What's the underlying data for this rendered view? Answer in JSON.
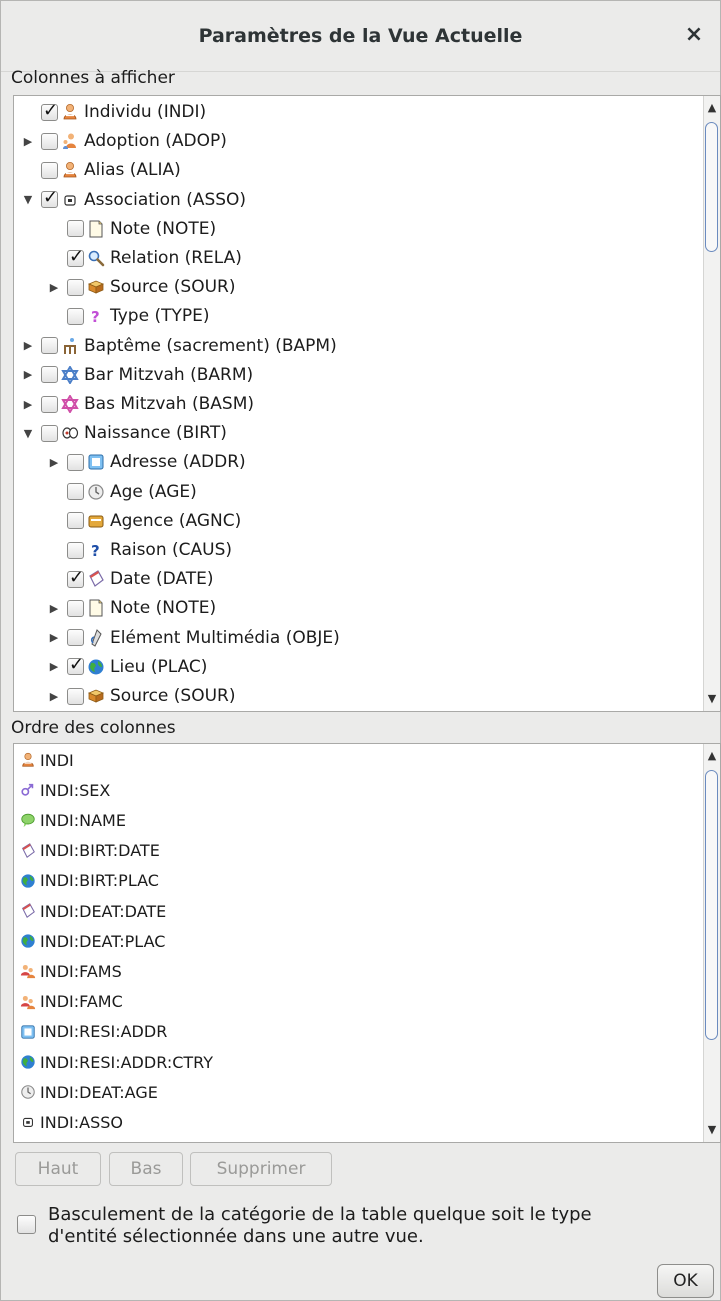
{
  "dialog": {
    "title": "Paramètres de la Vue Actuelle",
    "close_glyph": "×"
  },
  "columns_section": {
    "label": "Colonnes à afficher",
    "tree": [
      {
        "label": "Individu (INDI)",
        "checked": true,
        "toggle": "",
        "level": 0,
        "icon": "person-icon"
      },
      {
        "label": "Adoption (ADOP)",
        "checked": false,
        "toggle": "▶",
        "level": 0,
        "icon": "adoption-icon"
      },
      {
        "label": "Alias (ALIA)",
        "checked": false,
        "toggle": "",
        "level": 0,
        "icon": "person-icon"
      },
      {
        "label": "Association (ASSO)",
        "checked": true,
        "toggle": "▼",
        "level": 0,
        "icon": "association-icon"
      },
      {
        "label": "Note (NOTE)",
        "checked": false,
        "toggle": "",
        "level": 1,
        "icon": "note-icon"
      },
      {
        "label": "Relation (RELA)",
        "checked": true,
        "toggle": "",
        "level": 1,
        "icon": "magnifier-icon"
      },
      {
        "label": "Source (SOUR)",
        "checked": false,
        "toggle": "▶",
        "level": 1,
        "icon": "source-icon"
      },
      {
        "label": "Type (TYPE)",
        "checked": false,
        "toggle": "",
        "level": 1,
        "icon": "type-icon"
      },
      {
        "label": "Baptême (sacrement) (BAPM)",
        "checked": false,
        "toggle": "▶",
        "level": 0,
        "icon": "baptism-icon"
      },
      {
        "label": "Bar Mitzvah (BARM)",
        "checked": false,
        "toggle": "▶",
        "level": 0,
        "icon": "star-of-david-blue-icon"
      },
      {
        "label": "Bas Mitzvah (BASM)",
        "checked": false,
        "toggle": "▶",
        "level": 0,
        "icon": "star-of-david-pink-icon"
      },
      {
        "label": "Naissance (BIRT)",
        "checked": false,
        "toggle": "▼",
        "level": 0,
        "icon": "birth-icon"
      },
      {
        "label": "Adresse (ADDR)",
        "checked": false,
        "toggle": "▶",
        "level": 1,
        "icon": "address-icon"
      },
      {
        "label": "Age (AGE)",
        "checked": false,
        "toggle": "",
        "level": 1,
        "icon": "age-icon"
      },
      {
        "label": "Agence (AGNC)",
        "checked": false,
        "toggle": "",
        "level": 1,
        "icon": "agency-icon"
      },
      {
        "label": "Raison (CAUS)",
        "checked": false,
        "toggle": "",
        "level": 1,
        "icon": "question-icon"
      },
      {
        "label": "Date (DATE)",
        "checked": true,
        "toggle": "",
        "level": 1,
        "icon": "date-icon"
      },
      {
        "label": "Note (NOTE)",
        "checked": false,
        "toggle": "▶",
        "level": 1,
        "icon": "note-icon"
      },
      {
        "label": "Elément Multimédia (OBJE)",
        "checked": false,
        "toggle": "▶",
        "level": 1,
        "icon": "media-icon"
      },
      {
        "label": "Lieu (PLAC)",
        "checked": true,
        "toggle": "▶",
        "level": 1,
        "icon": "globe-icon"
      },
      {
        "label": "Source (SOUR)",
        "checked": false,
        "toggle": "▶",
        "level": 1,
        "icon": "source-icon"
      }
    ]
  },
  "order_section": {
    "label": "Ordre des colonnes",
    "items": [
      {
        "label": "INDI",
        "icon": "person-icon"
      },
      {
        "label": "INDI:SEX",
        "icon": "sex-icon"
      },
      {
        "label": "INDI:NAME",
        "icon": "name-icon"
      },
      {
        "label": "INDI:BIRT:DATE",
        "icon": "date-icon"
      },
      {
        "label": "INDI:BIRT:PLAC",
        "icon": "globe-icon"
      },
      {
        "label": "INDI:DEAT:DATE",
        "icon": "date-icon"
      },
      {
        "label": "INDI:DEAT:PLAC",
        "icon": "globe-icon"
      },
      {
        "label": "INDI:FAMS",
        "icon": "family-icon"
      },
      {
        "label": "INDI:FAMC",
        "icon": "family-icon"
      },
      {
        "label": "INDI:RESI:ADDR",
        "icon": "address-icon"
      },
      {
        "label": "INDI:RESI:ADDR:CTRY",
        "icon": "globe-icon"
      },
      {
        "label": "INDI:DEAT:AGE",
        "icon": "age-icon"
      },
      {
        "label": "INDI:ASSO",
        "icon": "association-icon"
      }
    ]
  },
  "buttons": {
    "up": "Haut",
    "down": "Bas",
    "delete": "Supprimer",
    "ok": "OK"
  },
  "toggle_option": {
    "checked": false,
    "label_line1": "Basculement de la catégorie de la table quelque soit le type",
    "label_line2": "d'entité sélectionnée dans une autre vue."
  }
}
